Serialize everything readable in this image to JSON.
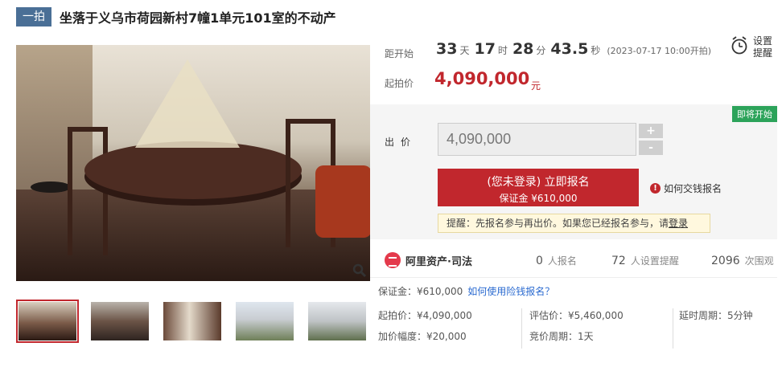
{
  "header": {
    "badge": "一拍",
    "title": "坐落于义乌市荷园新村7幢1单元101室的不动产"
  },
  "countdown": {
    "label": "距开始",
    "days": "33",
    "days_unit": "天",
    "hours": "17",
    "hours_unit": "时",
    "minutes": "28",
    "minutes_unit": "分",
    "seconds": "43.5",
    "seconds_unit": "秒",
    "start_note": "(2023-07-17 10:00开拍)"
  },
  "start_price": {
    "label": "起拍价",
    "value": "4,090,000",
    "unit": "元"
  },
  "alarm": {
    "label": "设置提醒",
    "icon": "alarm-clock-icon"
  },
  "bid": {
    "status_tag": "即将开始",
    "label": "出价",
    "input_value": "4,090,000",
    "plus": "+",
    "minus": "-",
    "apply_line1": "(您未登录) 立即报名",
    "apply_line2": "保证金 ¥610,000",
    "how_pay": "如何交钱报名",
    "reminder_text": "提醒：先报名参与再出价。如果您已经报名参与，请",
    "reminder_link": "登录"
  },
  "stats": {
    "brand": "阿里资产·司法",
    "signups_num": "0",
    "signups_label": "人报名",
    "reminders_num": "72",
    "reminders_label": "人设置提醒",
    "views_num": "2096",
    "views_label": "次围观"
  },
  "details": {
    "deposit": "保证金：¥610,000",
    "insurance_link": "如何使用险钱报名？",
    "start_price": "起拍价：¥4,090,000",
    "increment": "加价幅度：¥20,000",
    "appraisal": "评估价：¥5,460,000",
    "bid_cycle": "竞价周期：1天",
    "delay_cycle": "延时周期：5分钟"
  },
  "colors": {
    "accent": "#c1272d",
    "badge": "#4a6f96",
    "status_green": "#2ca35a",
    "link": "#2a6ad0"
  }
}
